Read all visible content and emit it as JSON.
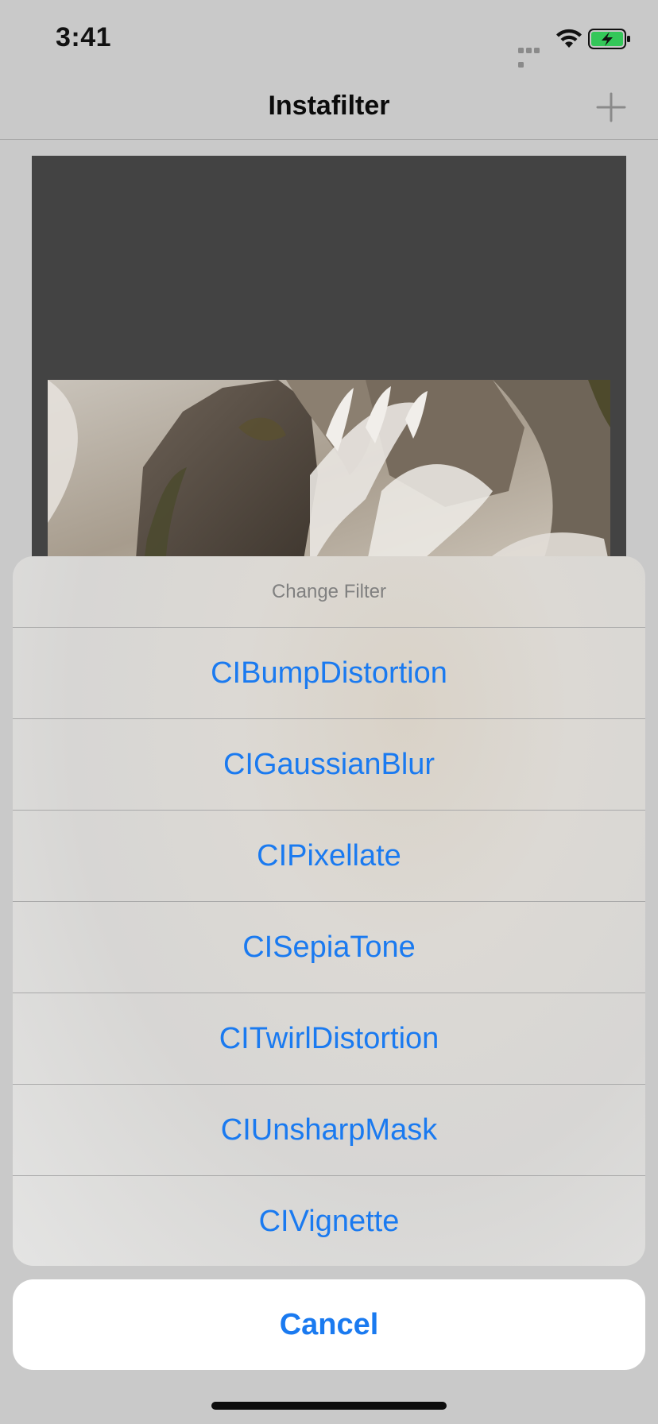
{
  "status_bar": {
    "time": "3:41",
    "icons": [
      "signal-icon",
      "wifi-icon",
      "battery-charging-icon"
    ],
    "battery_color": "#34c759"
  },
  "nav_bar": {
    "title": "Instafilter",
    "add_icon": "plus-icon"
  },
  "action_sheet": {
    "title": "Change Filter",
    "options": [
      "CIBumpDistortion",
      "CIGaussianBlur",
      "CIPixellate",
      "CISepiaTone",
      "CITwirlDistortion",
      "CIUnsharpMask",
      "CIVignette"
    ],
    "cancel_label": "Cancel"
  },
  "colors": {
    "accent": "#1a7af0",
    "frame_background": "#434343",
    "photo_tone": "sepia"
  }
}
